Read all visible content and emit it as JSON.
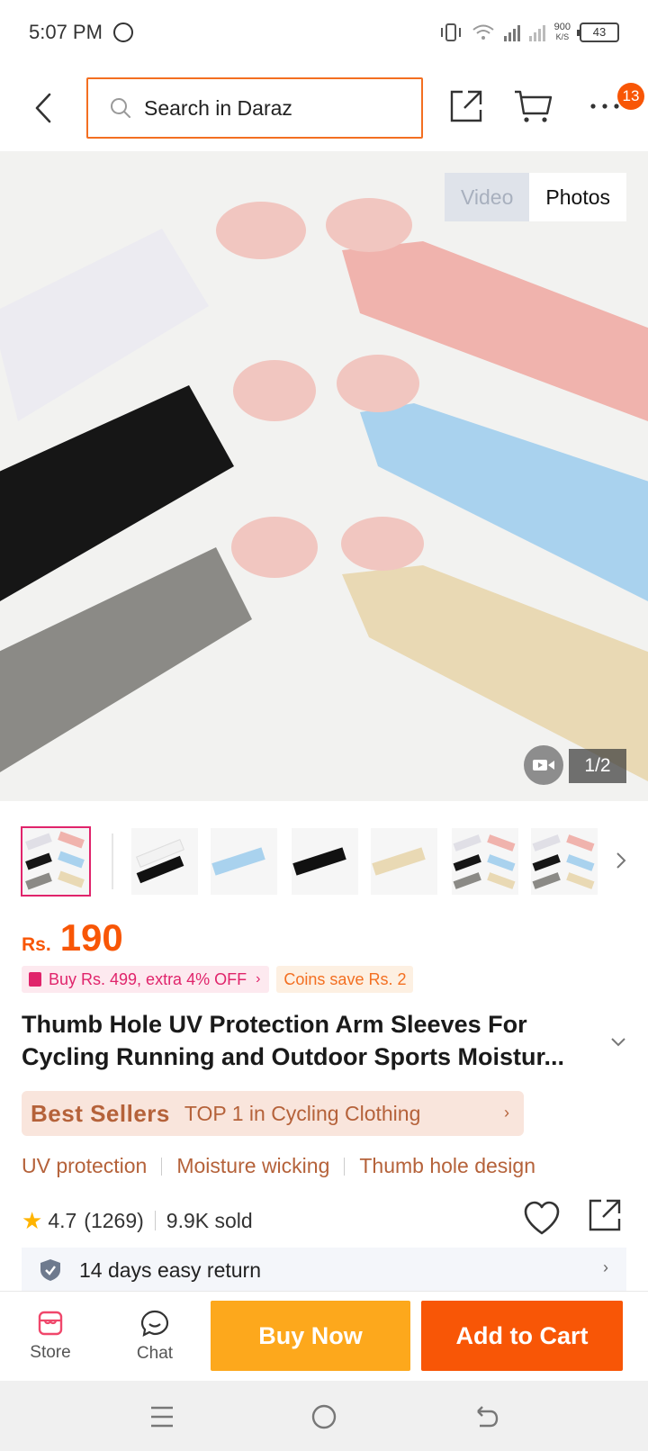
{
  "status_bar": {
    "time": "5:07 PM",
    "net_speed_value": "900",
    "net_speed_unit": "K/S",
    "battery": "43"
  },
  "header": {
    "search_placeholder": "Search in Daraz",
    "cart_badge_count": "13"
  },
  "gallery": {
    "video_tab": "Video",
    "photos_tab": "Photos",
    "counter": "1/2",
    "sleeve_colors": [
      "#ecebf1",
      "#f0b3ad",
      "#161616",
      "#a9d2ee",
      "#8b8a86",
      "#e9d9b4"
    ]
  },
  "product": {
    "currency": "Rs.",
    "price": "190",
    "promo_bundle": "Buy Rs. 499, extra 4% OFF",
    "promo_coins": "Coins save Rs. 2",
    "title": "Thumb Hole UV Protection Arm Sleeves For Cycling Running and Outdoor Sports Moistur...",
    "bestseller_badge": "Best Sellers",
    "bestseller_rank": "TOP 1 in Cycling Clothing",
    "features": [
      "UV protection",
      "Moisture wicking",
      "Thumb hole design"
    ],
    "rating": "4.7",
    "review_count": "(1269)",
    "sold": "9.9K sold",
    "return_policy": "14 days easy return"
  },
  "bottom_bar": {
    "store_label": "Store",
    "chat_label": "Chat",
    "buy_now": "Buy Now",
    "add_to_cart": "Add to Cart"
  },
  "colors": {
    "brand_orange": "#f85606",
    "buy_now_yellow": "#fda81c",
    "promo_pink": "#e0246b",
    "bestseller_brown": "#b5623a"
  }
}
